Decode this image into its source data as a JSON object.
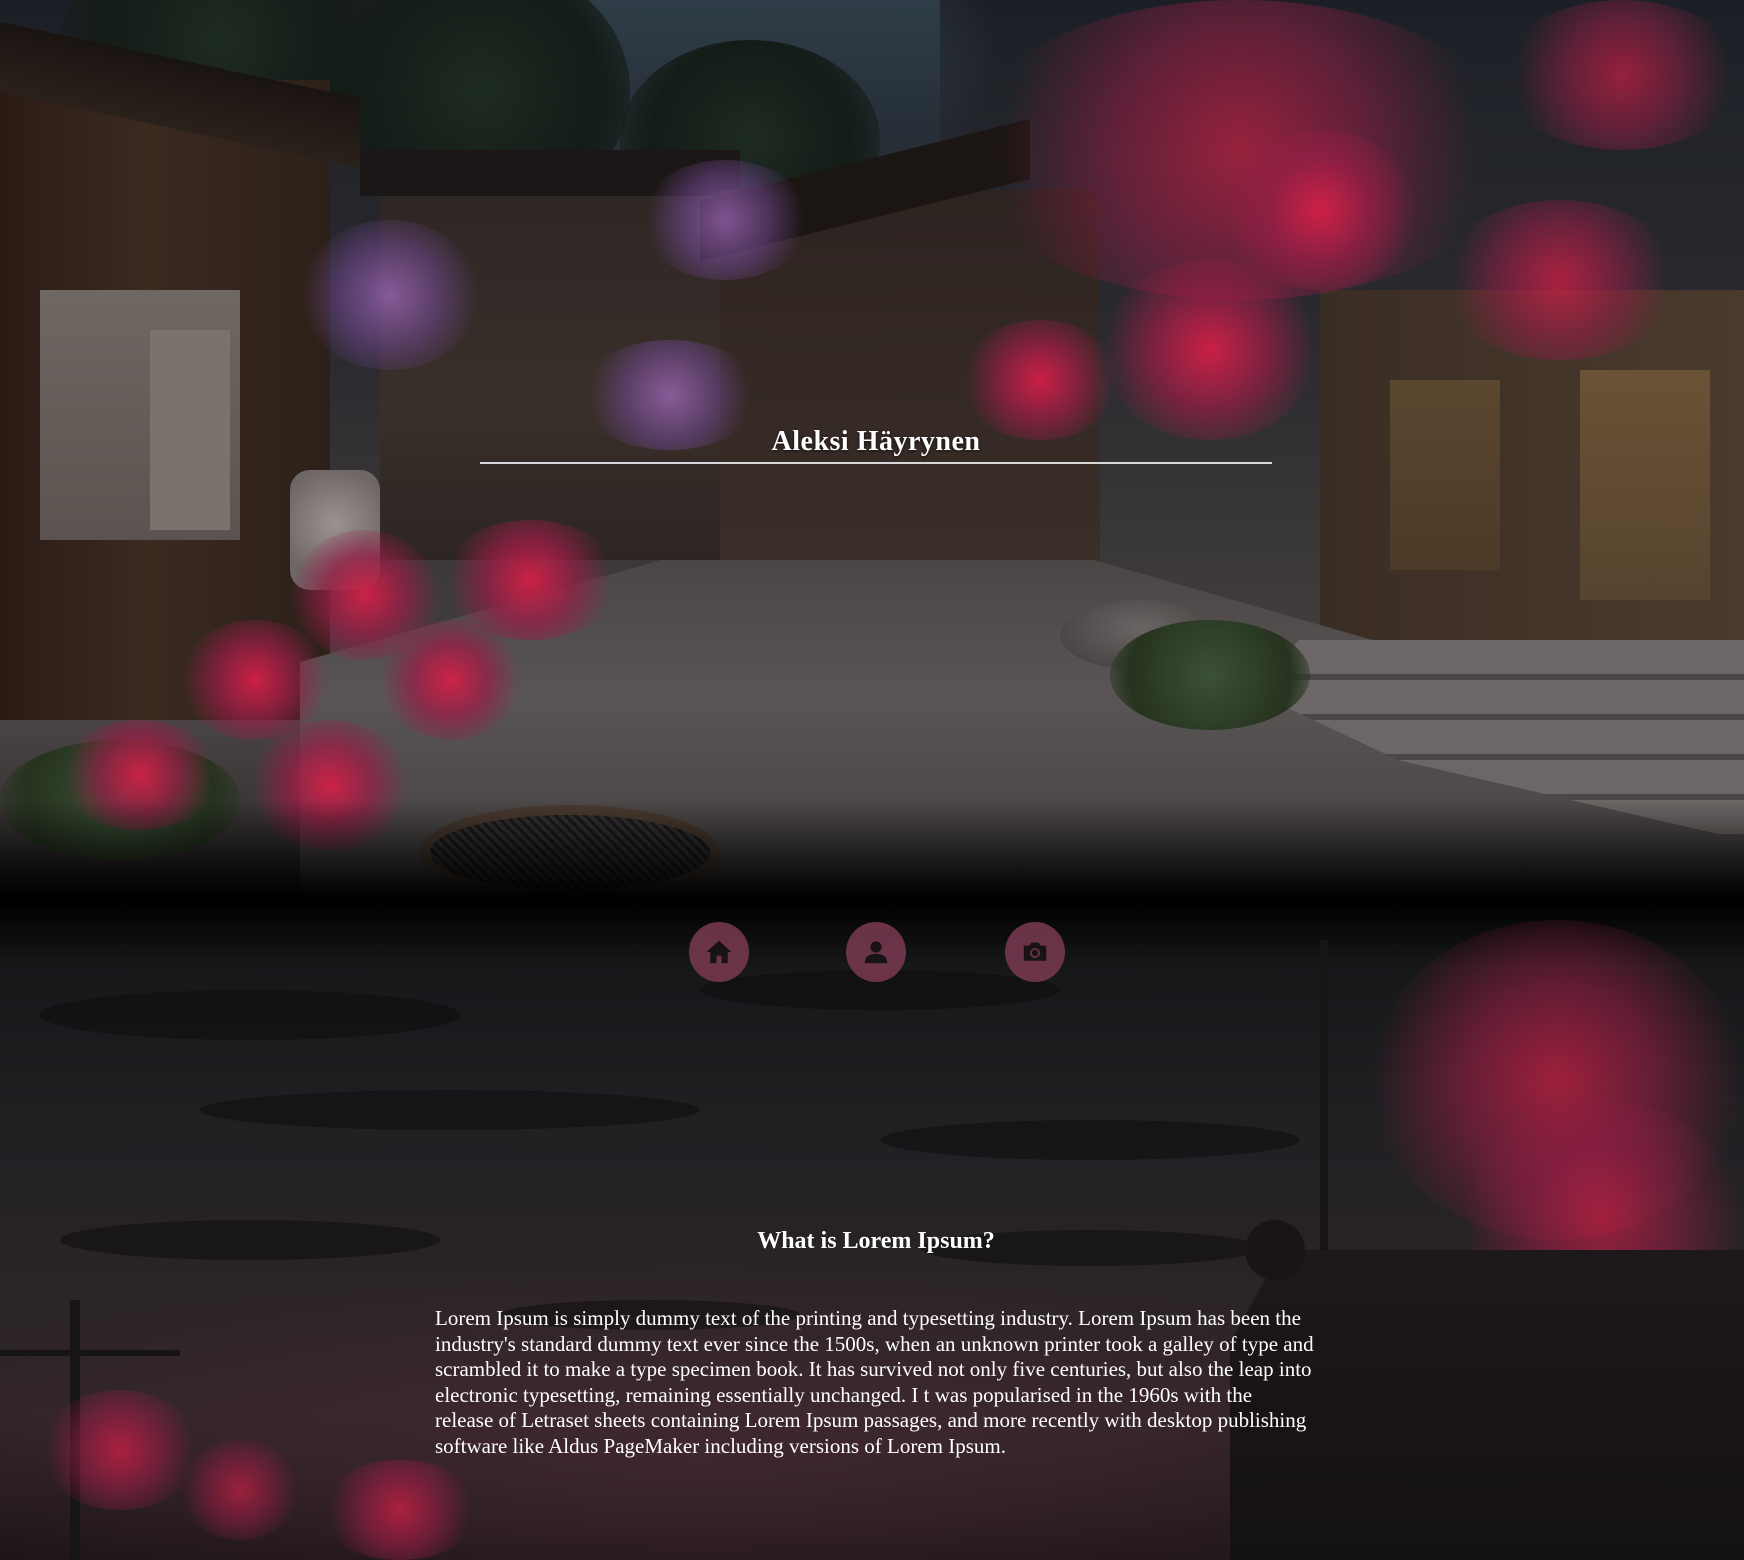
{
  "header": {
    "title": "Aleksi Häyrynen"
  },
  "nav": {
    "items": [
      {
        "name": "home",
        "icon": "home-icon"
      },
      {
        "name": "profile",
        "icon": "user-icon"
      },
      {
        "name": "gallery",
        "icon": "camera-icon"
      }
    ]
  },
  "article": {
    "heading": "What is Lorem Ipsum?",
    "body": "Lorem Ipsum is simply dummy text of the printing and typesetting industry. Lorem Ipsum has been the industry's standard dummy text ever since the 1500s, when an unknown printer took a galley of type and scrambled it to make a type specimen book. It has survived not only five centuries, but also the leap into electronic typesetting, remaining essentially unchanged. I t was popularised in the 1960s with the release of Letraset sheets containing Lorem Ipsum passages, and more recently with desktop publishing software like Aldus PageMaker including versions of Lorem Ipsum."
  },
  "colors": {
    "accent": "#7a3a52",
    "text": "#ffffff",
    "background": "#000000",
    "blossom": "#d22046"
  }
}
